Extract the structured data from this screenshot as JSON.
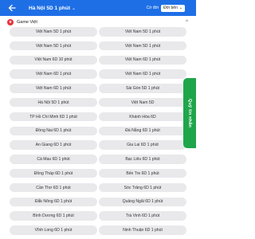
{
  "header": {
    "title": "Hà Nội 5D 1 phút",
    "title_caret": "⌄",
    "with_label": "Cờ đời",
    "with_value": "Đời bên",
    "with_caret": "⌄",
    "bg_color": "#1e6fe6"
  },
  "section": {
    "title": "Game Việt",
    "icon": "game-icon",
    "collapse_glyph": "^"
  },
  "games": [
    "Việt Nam 5D 1 phút",
    "Việt Nam 5D 1 phút",
    "Việt Nam 5D 1 phút",
    "Việt Nam 5D 1 phút",
    "Việt Nam 6D 10 phút",
    "Việt Nam 6D 1 phút",
    "Việt Nam 6D 1 phút",
    "Việt Nam 6D 1 phút",
    "Việt Nam 6D 1 phút",
    "Sài Gòn 5D 1 phút",
    "Hà Nội 5D 1 phút",
    "Việt Nam 5D",
    "TP Hồ Chí Minh 6D 1 phút",
    "Khánh Hòa 6D",
    "Đồng Nai 6D 1 phút",
    "Đà Nẵng 6D 1 phút",
    "An Giang 6D 1 phút",
    "Gia Lai 6D 1 phút",
    "Cà Mau 6D 1 phút",
    "Bạc Liêu 6D 1 phút",
    "Đồng Tháp 6D 1 phút",
    "Bến Tre 6D 1 phút",
    "Cần Thơ 6D 1 phút",
    "Sóc Trăng 6D 1 phút",
    "Đắk Nông 6D 1 phút",
    "Quảng Ngãi 6D 1 phút",
    "Bình Dương 6D 1 phút",
    "Trà Vinh 6D 1 phút",
    "Vĩnh Long 6D 1 phút",
    "Ninh Thuận 6D 1 phút"
  ],
  "side_tab": {
    "label": "Quỹ tin nhắn",
    "color": "#1fa64a"
  }
}
